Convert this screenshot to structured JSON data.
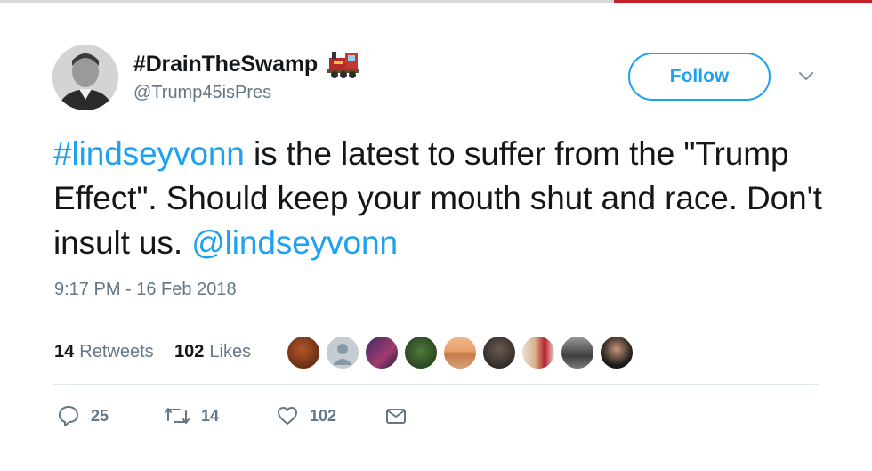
{
  "header": {
    "display_name": "#DrainTheSwamp",
    "name_emoji": "train-icon",
    "handle": "@Trump45isPres",
    "follow_label": "Follow",
    "menu_icon": "chevron-down-icon"
  },
  "tweet": {
    "segments": [
      {
        "text": "#lindseyvonn",
        "type": "hashtag"
      },
      {
        "text": " is the latest to suffer from the \"Trump Effect\". Should keep your mouth shut and race. Don't insult us. ",
        "type": "text"
      },
      {
        "text": "@lindseyvonn",
        "type": "mention"
      }
    ],
    "timestamp": "9:17 PM - 16 Feb 2018"
  },
  "stats": {
    "retweets_count": "14",
    "retweets_label": "Retweets",
    "likes_count": "102",
    "likes_label": "Likes"
  },
  "likers": [
    "liker-1",
    "liker-2",
    "liker-3",
    "liker-4",
    "liker-5",
    "liker-6",
    "liker-7",
    "liker-8",
    "liker-9"
  ],
  "actions": {
    "reply_count": "25",
    "retweet_count": "14",
    "like_count": "102"
  },
  "colors": {
    "link": "#1da1f2",
    "text": "#14171a",
    "secondary": "#657786",
    "divider": "#e1e8ed"
  }
}
